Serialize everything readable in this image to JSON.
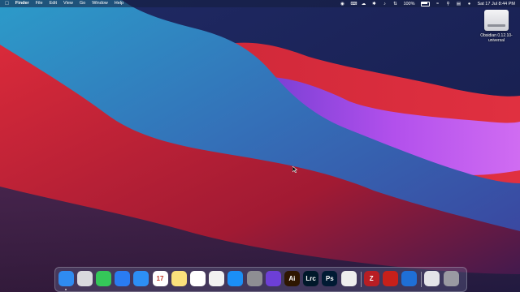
{
  "menubar": {
    "apple": "",
    "items": [
      "Finder",
      "File",
      "Edit",
      "View",
      "Go",
      "Window",
      "Help"
    ],
    "status": {
      "battery_percent": "100%",
      "datetime": "Sat 17 Jul 8:44 PM"
    }
  },
  "desktop": {
    "disk_label": "Obsidian 0.12.10-universal"
  },
  "dock": {
    "apps": [
      {
        "name": "Finder",
        "glyph": "",
        "color": "#2f8bf0"
      },
      {
        "name": "Launchpad",
        "glyph": "",
        "color": "#d9d9de"
      },
      {
        "name": "Messages",
        "glyph": "",
        "color": "#35c759"
      },
      {
        "name": "Mail",
        "glyph": "",
        "color": "#2a7cf2"
      },
      {
        "name": "Safari",
        "glyph": "",
        "color": "#2d8ff5"
      },
      {
        "name": "Calendar",
        "glyph": "17",
        "color": "#ffffff"
      },
      {
        "name": "Notes",
        "glyph": "",
        "color": "#fbe07c"
      },
      {
        "name": "Reminders",
        "glyph": "",
        "color": "#ffffff"
      },
      {
        "name": "Photos",
        "glyph": "",
        "color": "#f1f1f1"
      },
      {
        "name": "App Store",
        "glyph": "",
        "color": "#1b8ff6"
      },
      {
        "name": "System Preferences",
        "glyph": "",
        "color": "#8e8e93"
      },
      {
        "name": "iMovie",
        "glyph": "",
        "color": "#6d3fd6"
      },
      {
        "name": "Illustrator",
        "glyph": "Ai",
        "color": "#2e1600"
      },
      {
        "name": "Lightroom Classic",
        "glyph": "Lrc",
        "color": "#00182a"
      },
      {
        "name": "Photoshop",
        "glyph": "Ps",
        "color": "#001a33"
      },
      {
        "name": "Chrome",
        "glyph": "",
        "color": "#eeeeee"
      },
      {
        "name": "Zotero",
        "glyph": "Z",
        "color": "#b81e24"
      },
      {
        "name": "Acrobat",
        "glyph": "",
        "color": "#c7201a"
      },
      {
        "name": "Xcode",
        "glyph": "",
        "color": "#1f6fd6"
      },
      {
        "name": "Downloads",
        "glyph": "",
        "color": "#e3e3e8"
      },
      {
        "name": "Trash",
        "glyph": "",
        "color": "#9a9aa2"
      }
    ]
  }
}
